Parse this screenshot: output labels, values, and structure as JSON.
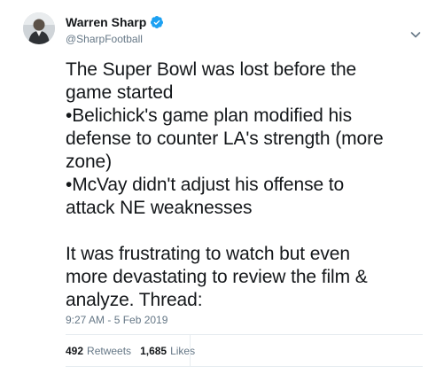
{
  "author": {
    "name": "Warren Sharp",
    "handle": "@SharpFootball",
    "verified": true
  },
  "tweet": {
    "text": "The Super Bowl was lost before the\ngame started\n•Belichick's game plan modified his\ndefense to counter LA's strength (more\nzone)\n•McVay didn't adjust his offense to\nattack NE weaknesses\n\nIt was frustrating to watch but even\nmore devastating to review the film &\nanalyze. Thread:",
    "timestamp": "9:27 AM - 5 Feb 2019"
  },
  "stats": {
    "retweets_count": "492",
    "retweets_label": "Retweets",
    "likes_count": "1,685",
    "likes_label": "Likes"
  },
  "icons": {
    "verified": "verified-badge-icon",
    "menu": "chevron-down-icon"
  },
  "colors": {
    "verified": "#1da1f2",
    "secondary_text": "#657786",
    "primary_text": "#14171a",
    "divider": "#e6ecf0"
  }
}
